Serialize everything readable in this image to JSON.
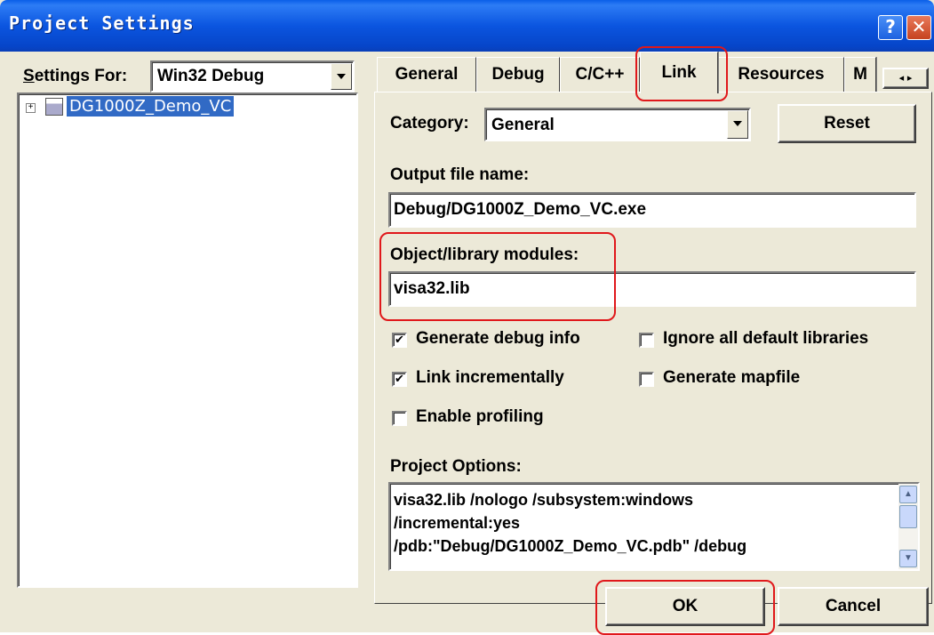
{
  "window": {
    "title": "Project Settings",
    "help_glyph": "?",
    "close_glyph": "✕"
  },
  "left": {
    "settings_for_label": "Settings For:",
    "settings_for_value": "Win32 Debug",
    "tree_item": "DG1000Z_Demo_VC"
  },
  "tabs": [
    {
      "label": "General"
    },
    {
      "label": "Debug"
    },
    {
      "label": "C/C++"
    },
    {
      "label": "Link"
    },
    {
      "label": "Resources"
    },
    {
      "label": "M"
    }
  ],
  "link": {
    "category_label": "Category:",
    "category_value": "General",
    "reset_label": "Reset",
    "output_label": "Output file name:",
    "output_value": "Debug/DG1000Z_Demo_VC.exe",
    "objlib_label": "Object/library modules:",
    "objlib_value": "visa32.lib",
    "checkboxes": [
      {
        "label": "Generate debug info",
        "checked": true
      },
      {
        "label": "Ignore all default libraries",
        "checked": false
      },
      {
        "label": "Link incrementally",
        "checked": true
      },
      {
        "label": "Generate mapfile",
        "checked": false
      },
      {
        "label": "Enable profiling",
        "checked": false
      }
    ],
    "project_options_label": "Project Options:",
    "project_options_lines": [
      "visa32.lib /nologo /subsystem:windows",
      "/incremental:yes",
      "/pdb:\"Debug/DG1000Z_Demo_VC.pdb\" /debug"
    ]
  },
  "footer": {
    "ok_label": "OK",
    "cancel_label": "Cancel"
  },
  "colors": {
    "titlebar": "#0a5ee8",
    "dialog_bg": "#ece9d8",
    "highlight": "#316ac5",
    "annotation": "#e0181b"
  }
}
